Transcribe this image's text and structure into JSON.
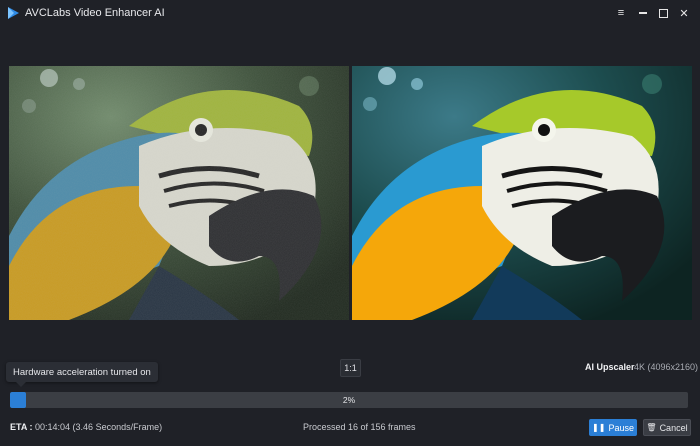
{
  "window": {
    "title": "AVCLabs Video Enhancer AI",
    "controls": [
      "menu-icon",
      "minimize-icon",
      "maximize-icon",
      "close-icon"
    ]
  },
  "preview": {
    "left_label": "original-frame",
    "right_label": "enhanced-frame"
  },
  "controls": {
    "ratio_label": "1:1",
    "model_name": "AI Upscaler",
    "model_resolution": "4K (4096x2160)"
  },
  "tooltip": {
    "text": "Hardware acceleration turned on"
  },
  "progress": {
    "value": 0.02,
    "label": "2%"
  },
  "status": {
    "eta_label": "ETA :",
    "eta_value": "00:14:04 (3.46 Seconds/Frame)",
    "processed": "Processed 16 of 156 frames"
  },
  "buttons": {
    "pause": "Pause",
    "cancel": "Cancel"
  },
  "colors": {
    "accent": "#2b7fd6",
    "background": "#1f2127",
    "track": "#3b3e44"
  }
}
